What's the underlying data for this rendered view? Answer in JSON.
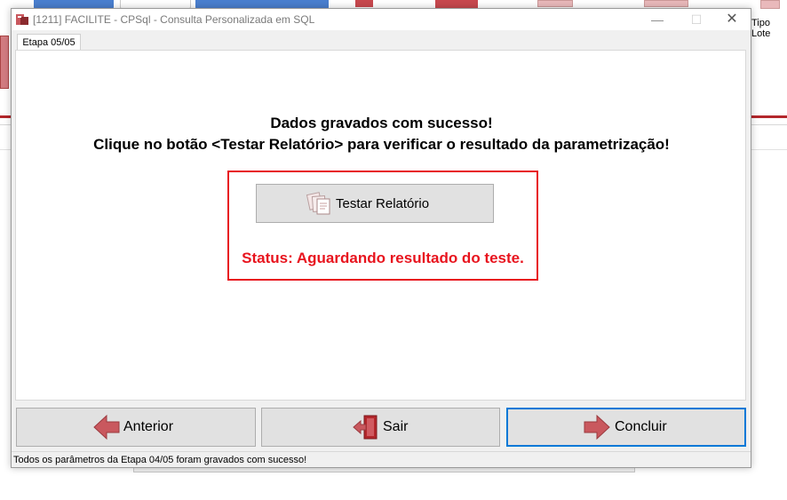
{
  "window": {
    "title": "[1211] FACILITE - CPSql - Consulta Personalizada em SQL",
    "minimize_glyph": "—",
    "maximize_glyph": "☐",
    "close_glyph": "✕"
  },
  "background": {
    "toolbar_label": "Tipo Lote"
  },
  "tabs": [
    {
      "label": "Etapa 05/05",
      "active": true
    }
  ],
  "main": {
    "message_line1": "Dados gravados com sucesso!",
    "message_line2": "Clique no botão <Testar Relatório> para verificar o resultado da parametrização!",
    "test_button_label": "Testar Relatório",
    "status_text": "Status: Aguardando resultado do teste."
  },
  "footer_buttons": {
    "previous_label": "Anterior",
    "exit_label": "Sair",
    "finish_label": "Concluir"
  },
  "statusbar": {
    "text": "Todos os parâmetros da Etapa 04/05 foram gravados com sucesso!"
  },
  "colors": {
    "highlight_border": "#e8141e",
    "status_text": "#e8141e",
    "focus_border": "#0078d7",
    "arrow_icon": "#c9585e",
    "background_accent": "#b3262b"
  },
  "icons": {
    "app": "facilite-app-icon",
    "test": "documents-icon",
    "previous": "arrow-left-icon",
    "exit": "exit-door-icon",
    "finish": "arrow-right-icon"
  }
}
